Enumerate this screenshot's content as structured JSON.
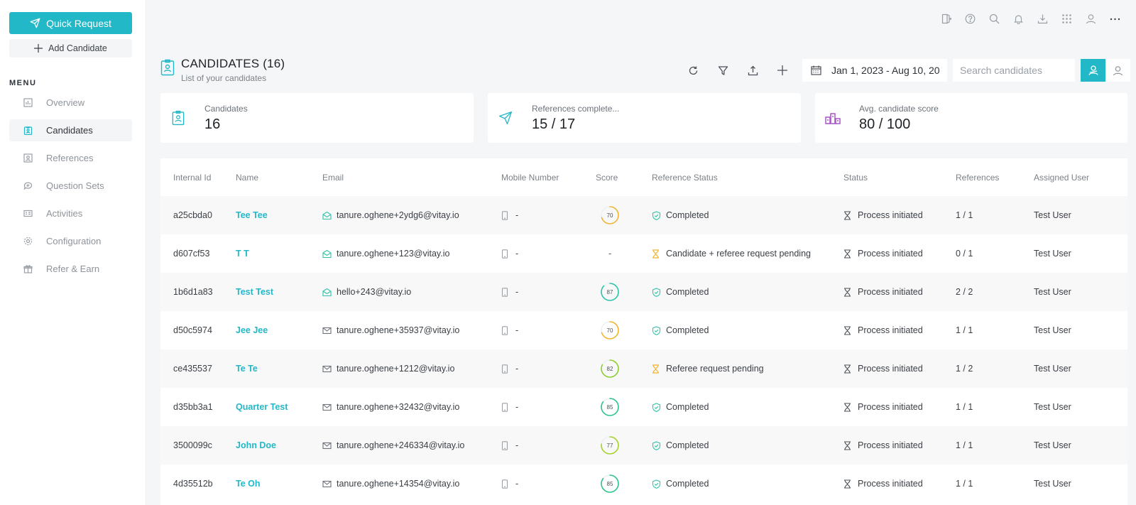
{
  "sidebar": {
    "quick_request": "Quick Request",
    "add_candidate": "Add Candidate",
    "menu_heading": "MENU",
    "items": [
      {
        "label": "Overview",
        "icon": "chart-icon"
      },
      {
        "label": "Candidates",
        "icon": "badge-icon",
        "active": true
      },
      {
        "label": "References",
        "icon": "contact-card-icon"
      },
      {
        "label": "Question Sets",
        "icon": "chat-icon"
      },
      {
        "label": "Activities",
        "icon": "activity-icon"
      },
      {
        "label": "Configuration",
        "icon": "gear-icon"
      },
      {
        "label": "Refer & Earn",
        "icon": "gift-icon"
      }
    ]
  },
  "topbar": {
    "icons": [
      "logout-icon",
      "help-icon",
      "search-icon",
      "bell-icon",
      "download-icon",
      "apps-grid-icon",
      "user-icon",
      "more-icon"
    ]
  },
  "header": {
    "title": "CANDIDATES (16)",
    "subtitle": "List of your candidates",
    "date_range": "Jan 1, 2023 - Aug 10, 20",
    "search_placeholder": "Search candidates"
  },
  "stats": [
    {
      "label": "Candidates",
      "value": "16",
      "icon": "badge-icon",
      "color": "#22b8c8"
    },
    {
      "label": "References complete...",
      "value": "15 / 17",
      "icon": "paper-plane-icon",
      "color": "#22b8c8"
    },
    {
      "label": "Avg. candidate score",
      "value": "80 / 100",
      "icon": "ranking-icon",
      "color": "#a855c9"
    }
  ],
  "table": {
    "columns": [
      "Internal Id",
      "Name",
      "Email",
      "Mobile Number",
      "Score",
      "Reference Status",
      "Status",
      "References",
      "Assigned User"
    ],
    "rows": [
      {
        "id": "a25cbda0",
        "name": "Tee Tee",
        "email": "tanure.oghene+2ydg6@vitay.io",
        "email_verified": true,
        "mobile": "-",
        "score": "70",
        "score_color": "#f2b531",
        "rstatus": "Completed",
        "rstatus_kind": "done",
        "status": "Process initiated",
        "refs": "1 / 1",
        "user": "Test User"
      },
      {
        "id": "d607cf53",
        "name": "T T",
        "email": "tanure.oghene+123@vitay.io",
        "email_verified": true,
        "mobile": "-",
        "score": "-",
        "score_color": "",
        "rstatus": "Candidate + referee request pending",
        "rstatus_kind": "pending",
        "status": "Process initiated",
        "refs": "0 / 1",
        "user": "Test User"
      },
      {
        "id": "1b6d1a83",
        "name": "Test Test",
        "email": "hello+243@vitay.io",
        "email_verified": true,
        "mobile": "-",
        "score": "87",
        "score_color": "#2ec4a8",
        "rstatus": "Completed",
        "rstatus_kind": "done",
        "status": "Process initiated",
        "refs": "2 / 2",
        "user": "Test User"
      },
      {
        "id": "d50c5974",
        "name": "Jee Jee",
        "email": "tanure.oghene+35937@vitay.io",
        "email_verified": false,
        "mobile": "-",
        "score": "70",
        "score_color": "#f2b531",
        "rstatus": "Completed",
        "rstatus_kind": "done",
        "status": "Process initiated",
        "refs": "1 / 1",
        "user": "Test User"
      },
      {
        "id": "ce435537",
        "name": "Te Te",
        "email": "tanure.oghene+1212@vitay.io",
        "email_verified": false,
        "mobile": "-",
        "score": "82",
        "score_color": "#8ccf2e",
        "rstatus": "Referee request pending",
        "rstatus_kind": "pending",
        "status": "Process initiated",
        "refs": "1 / 2",
        "user": "Test User"
      },
      {
        "id": "d35bb3a1",
        "name": "Quarter Test",
        "email": "tanure.oghene+32432@vitay.io",
        "email_verified": false,
        "mobile": "-",
        "score": "85",
        "score_color": "#2ec48a",
        "rstatus": "Completed",
        "rstatus_kind": "done",
        "status": "Process initiated",
        "refs": "1 / 1",
        "user": "Test User"
      },
      {
        "id": "3500099c",
        "name": "John Doe",
        "email": "tanure.oghene+246334@vitay.io",
        "email_verified": false,
        "mobile": "-",
        "score": "77",
        "score_color": "#a7d12e",
        "rstatus": "Completed",
        "rstatus_kind": "done",
        "status": "Process initiated",
        "refs": "1 / 1",
        "user": "Test User"
      },
      {
        "id": "4d35512b",
        "name": "Te Oh",
        "email": "tanure.oghene+14354@vitay.io",
        "email_verified": false,
        "mobile": "-",
        "score": "85",
        "score_color": "#2ec48a",
        "rstatus": "Completed",
        "rstatus_kind": "done",
        "status": "Process initiated",
        "refs": "1 / 1",
        "user": "Test User"
      }
    ]
  },
  "colors": {
    "accent": "#22b8c8",
    "pending": "#f2b531",
    "done": "#2ec4a8"
  }
}
